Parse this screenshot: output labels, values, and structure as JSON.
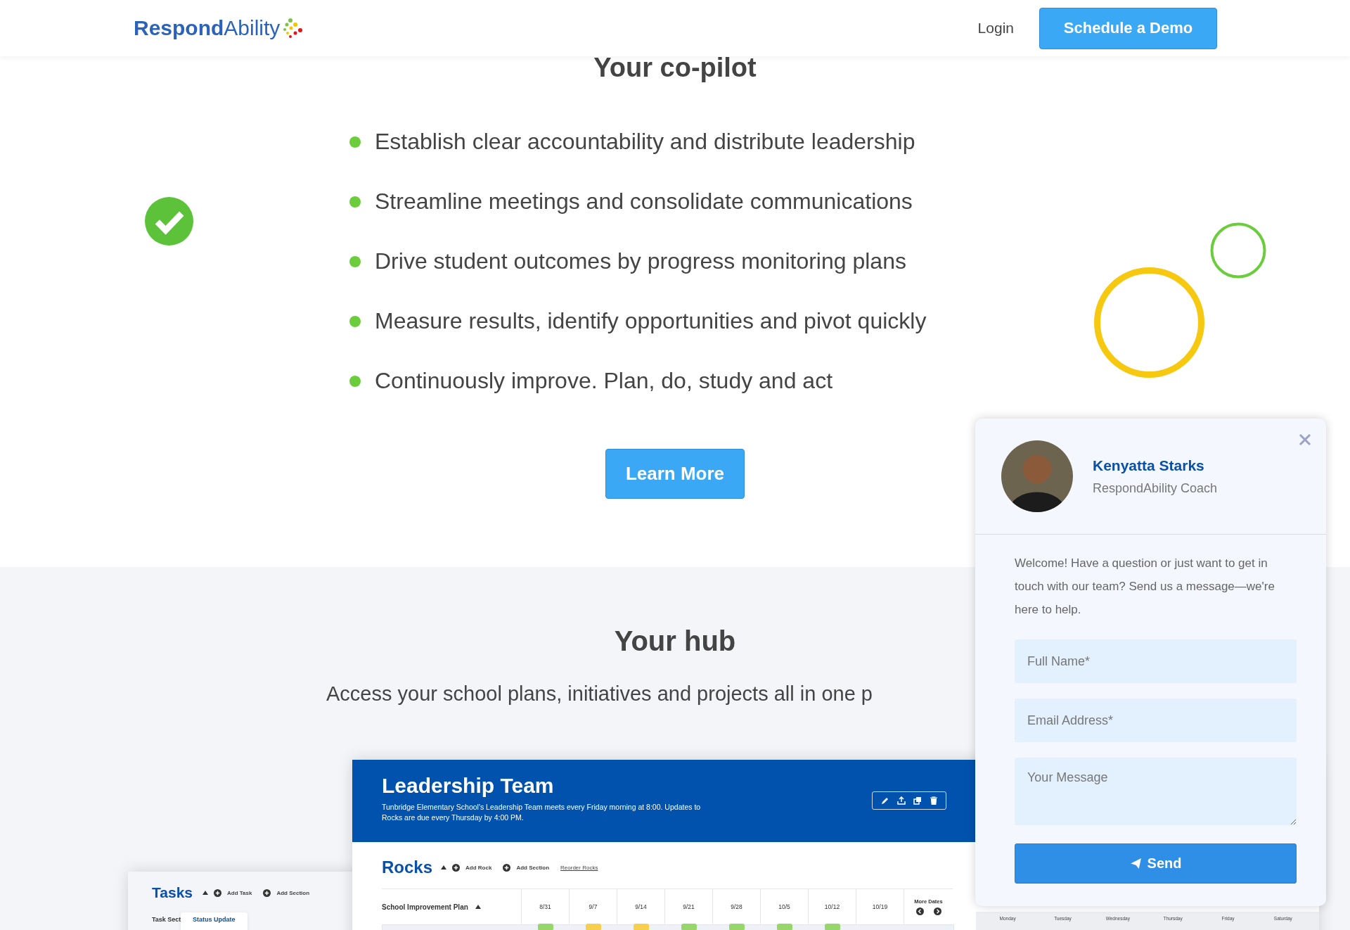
{
  "header": {
    "logo": {
      "bold": "Respond",
      "light": "Ability"
    },
    "login": "Login",
    "cta": "Schedule a Demo"
  },
  "copilot": {
    "title": "Your co-pilot",
    "bullets": [
      "Establish clear accountability and distribute leadership",
      "Streamline meetings and consolidate communications",
      "Drive student outcomes by progress monitoring plans",
      "Measure results, identify opportunities and pivot quickly",
      "Continuously improve. Plan, do, study and act"
    ],
    "button": "Learn More"
  },
  "hub": {
    "title": "Your hub",
    "subtitle": "Access your school plans, initiatives and projects all in one p"
  },
  "tasks_card": {
    "title": "Tasks",
    "actions": [
      "Add Task",
      "Add Section"
    ],
    "column": "Task Sect",
    "menu_item": "Status Update"
  },
  "leadership": {
    "title": "Leadership Team",
    "description": "Tunbridge Elementary School's Leadership Team meets every Friday morning at 8:00. Updates to Rocks are due every Thursday by 4:00 PM.",
    "rocks_title": "Rocks",
    "rocks_actions": [
      "Add Rock",
      "Add Section"
    ],
    "reorder": "Reorder Rocks",
    "plan": "School Improvement Plan",
    "dates": [
      "8/31",
      "9/7",
      "9/14",
      "9/21",
      "9/28",
      "10/5",
      "10/12",
      "10/19"
    ],
    "more_dates": "More Dates",
    "statuses": [
      {
        "color": "#97d66b"
      },
      {
        "color": "#f6d04d"
      },
      {
        "color": "#f6d04d"
      },
      {
        "color": "#97d66b"
      },
      {
        "color": "#97d66b"
      },
      {
        "color": "#97d66b"
      },
      {
        "color": "#97d66b"
      }
    ]
  },
  "calendar": {
    "days": [
      "Monday",
      "Tuesday",
      "Wednesday",
      "Thursday",
      "Friday",
      "Saturday"
    ]
  },
  "chat": {
    "name": "Kenyatta Starks",
    "role": "RespondAbility Coach",
    "welcome": "Welcome! Have a question or just want to get in touch with our team? Send us a message—we're here to help.",
    "fields": [
      {
        "placeholder": "Full Name*"
      },
      {
        "placeholder": "Email Address*"
      }
    ],
    "message": {
      "placeholder": "Your Message"
    },
    "send": "Send"
  }
}
